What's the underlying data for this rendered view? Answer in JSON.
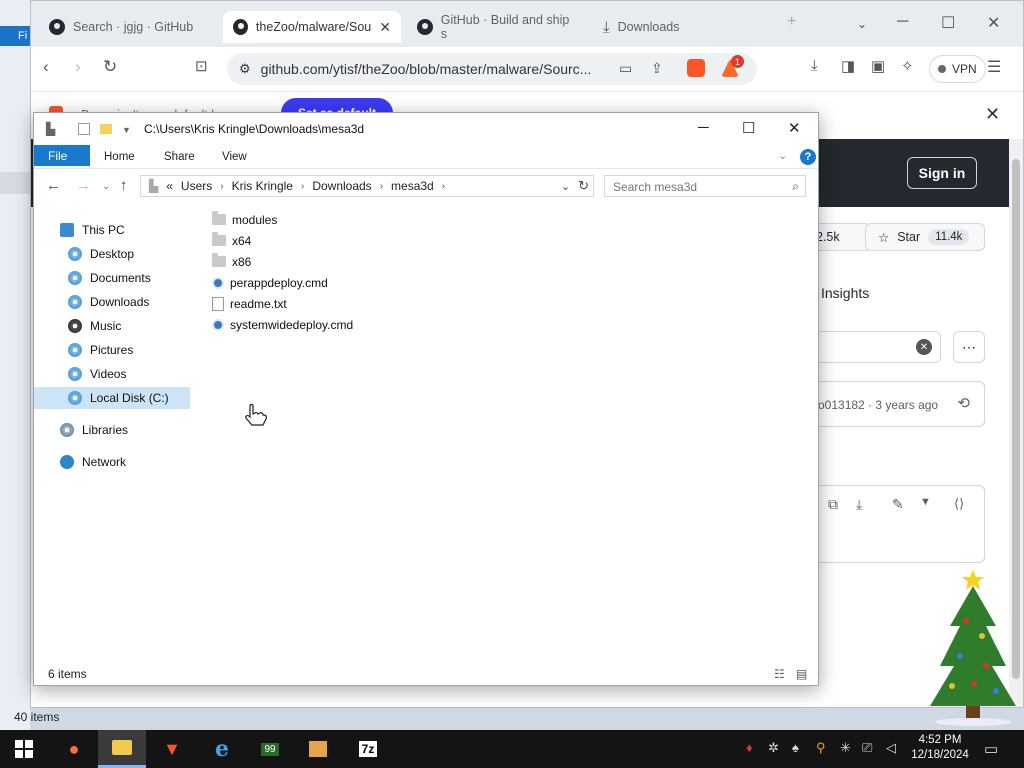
{
  "desktop": {
    "left_tab_label": "Fi"
  },
  "browser": {
    "tabs": [
      {
        "label": "Search · jgjg · GitHub"
      },
      {
        "label": "theZoo/malware/Sou"
      },
      {
        "label": "GitHub · Build and ship s"
      },
      {
        "label": "Downloads"
      }
    ],
    "url": "github.com/ytisf/theZoo/blob/master/malware/Sourc...",
    "vpn_label": "VPN",
    "notification_badge": "1",
    "infobar": {
      "text": "Brave isn't your default browser",
      "button": "Set as default"
    },
    "github": {
      "signin": "Sign in",
      "fork_count": "2.5k",
      "star_label": "Star",
      "star_count": "11.4k",
      "insights": "Insights",
      "commit_text": "o013182 · 3 years ago"
    },
    "status_items": "40 items"
  },
  "explorer": {
    "title_path": "C:\\Users\\Kris Kringle\\Downloads\\mesa3d",
    "ribbon": {
      "file": "File",
      "home": "Home",
      "share": "Share",
      "view": "View",
      "help": "?"
    },
    "breadcrumb": [
      "«",
      "Users",
      "Kris Kringle",
      "Downloads",
      "mesa3d"
    ],
    "search_placeholder": "Search mesa3d",
    "nav": {
      "this_pc": "This PC",
      "desktop": "Desktop",
      "documents": "Documents",
      "downloads": "Downloads",
      "music": "Music",
      "pictures": "Pictures",
      "videos": "Videos",
      "local_disk": "Local Disk (C:)",
      "libraries": "Libraries",
      "network": "Network"
    },
    "files": [
      {
        "name": "modules",
        "type": "folder"
      },
      {
        "name": "x64",
        "type": "folder"
      },
      {
        "name": "x86",
        "type": "folder"
      },
      {
        "name": "perappdeploy.cmd",
        "type": "cmd"
      },
      {
        "name": "readme.txt",
        "type": "txt"
      },
      {
        "name": "systemwidedeploy.cmd",
        "type": "cmd"
      }
    ],
    "status": "6 items"
  },
  "taskbar": {
    "clock_time": "4:52 PM",
    "clock_date": "12/18/2024",
    "badge_99": "99",
    "sevenzip_label": "7z"
  }
}
